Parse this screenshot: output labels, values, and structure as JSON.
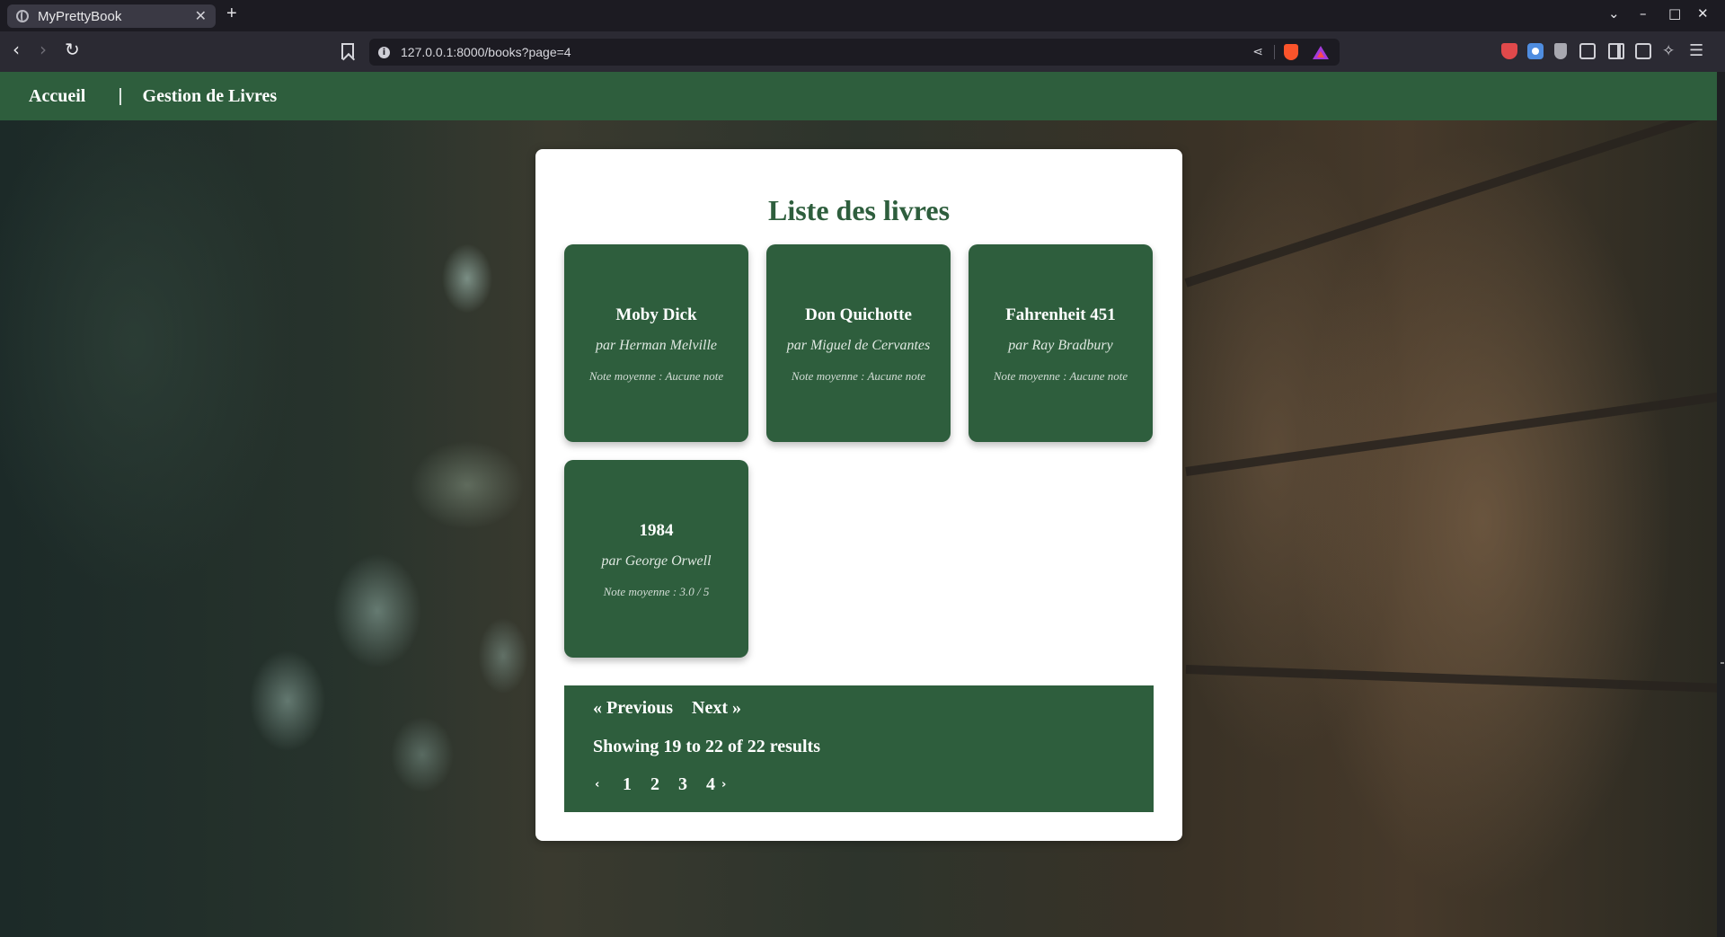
{
  "browser": {
    "tab_title": "MyPrettyBook",
    "tab_close": "✕",
    "new_tab": "+",
    "url": "127.0.0.1:8000/books?page=4",
    "window_controls": {
      "chevron": "⌄",
      "minimize": "–",
      "maximize": "□",
      "close": "✕"
    },
    "nav": {
      "back": "‹",
      "forward": "›",
      "reload": "↻"
    }
  },
  "site_nav": {
    "home": "Accueil",
    "separator": "|",
    "manage": "Gestion de Livres"
  },
  "main": {
    "heading": "Liste des livres",
    "books": [
      {
        "title": "Moby Dick",
        "author": "par Herman Melville",
        "rating": "Note moyenne : Aucune note"
      },
      {
        "title": "Don Quichotte",
        "author": "par Miguel de Cervantes",
        "rating": "Note moyenne : Aucune note"
      },
      {
        "title": "Fahrenheit 451",
        "author": "par Ray Bradbury",
        "rating": "Note moyenne : Aucune note"
      },
      {
        "title": "1984",
        "author": "par George Orwell",
        "rating": "Note moyenne : 3.0 / 5"
      }
    ]
  },
  "pagination": {
    "previous": "« Previous",
    "next": "Next »",
    "summary": "Showing 19 to 22 of 22 results",
    "prev_chevron": "‹",
    "next_chevron": "›",
    "pages": [
      "1",
      "2",
      "3",
      "4"
    ]
  },
  "colors": {
    "brand_green": "#2e5e3d",
    "card_background": "#2e5e3d",
    "container": "#ffffff"
  }
}
